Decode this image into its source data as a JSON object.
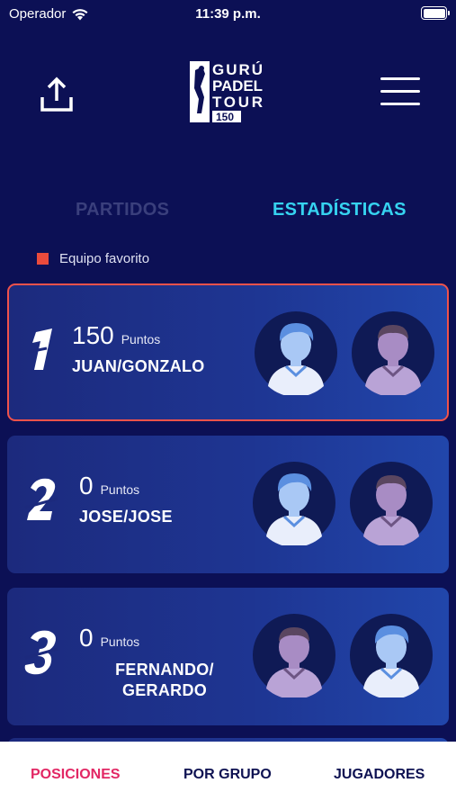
{
  "status_bar": {
    "carrier": "Operador",
    "time": "11:39 p.m."
  },
  "header": {
    "logo_text": [
      "GURÚ",
      "PADEL",
      "TOUR",
      "150"
    ],
    "share_icon": "share-icon",
    "menu_icon": "hamburger-menu-icon"
  },
  "tabs": [
    {
      "label": "PARTIDOS",
      "active": false
    },
    {
      "label": "ESTADÍSTICAS",
      "active": true
    }
  ],
  "legend": {
    "label": "Equipo favorito",
    "color": "#ea4b3c"
  },
  "rankings": [
    {
      "rank": "1",
      "points": "150",
      "points_label": "Puntos",
      "team": "JUAN/GONZALO",
      "favorite": true
    },
    {
      "rank": "2",
      "points": "0",
      "points_label": "Puntos",
      "team": "JOSE/JOSE",
      "favorite": false
    },
    {
      "rank": "3",
      "points": "0",
      "points_label": "Puntos",
      "team_line1": "FERNANDO/",
      "team_line2": "GERARDO",
      "favorite": false
    }
  ],
  "bottom_nav": [
    {
      "label": "POSICIONES",
      "active": true
    },
    {
      "label": "POR GRUPO",
      "active": false
    },
    {
      "label": "JUGADORES",
      "active": false
    }
  ],
  "colors": {
    "background": "#0c1055",
    "accent_cyan": "#36d3f0",
    "accent_pink": "#e22764",
    "favorite_border": "#f0524b"
  }
}
